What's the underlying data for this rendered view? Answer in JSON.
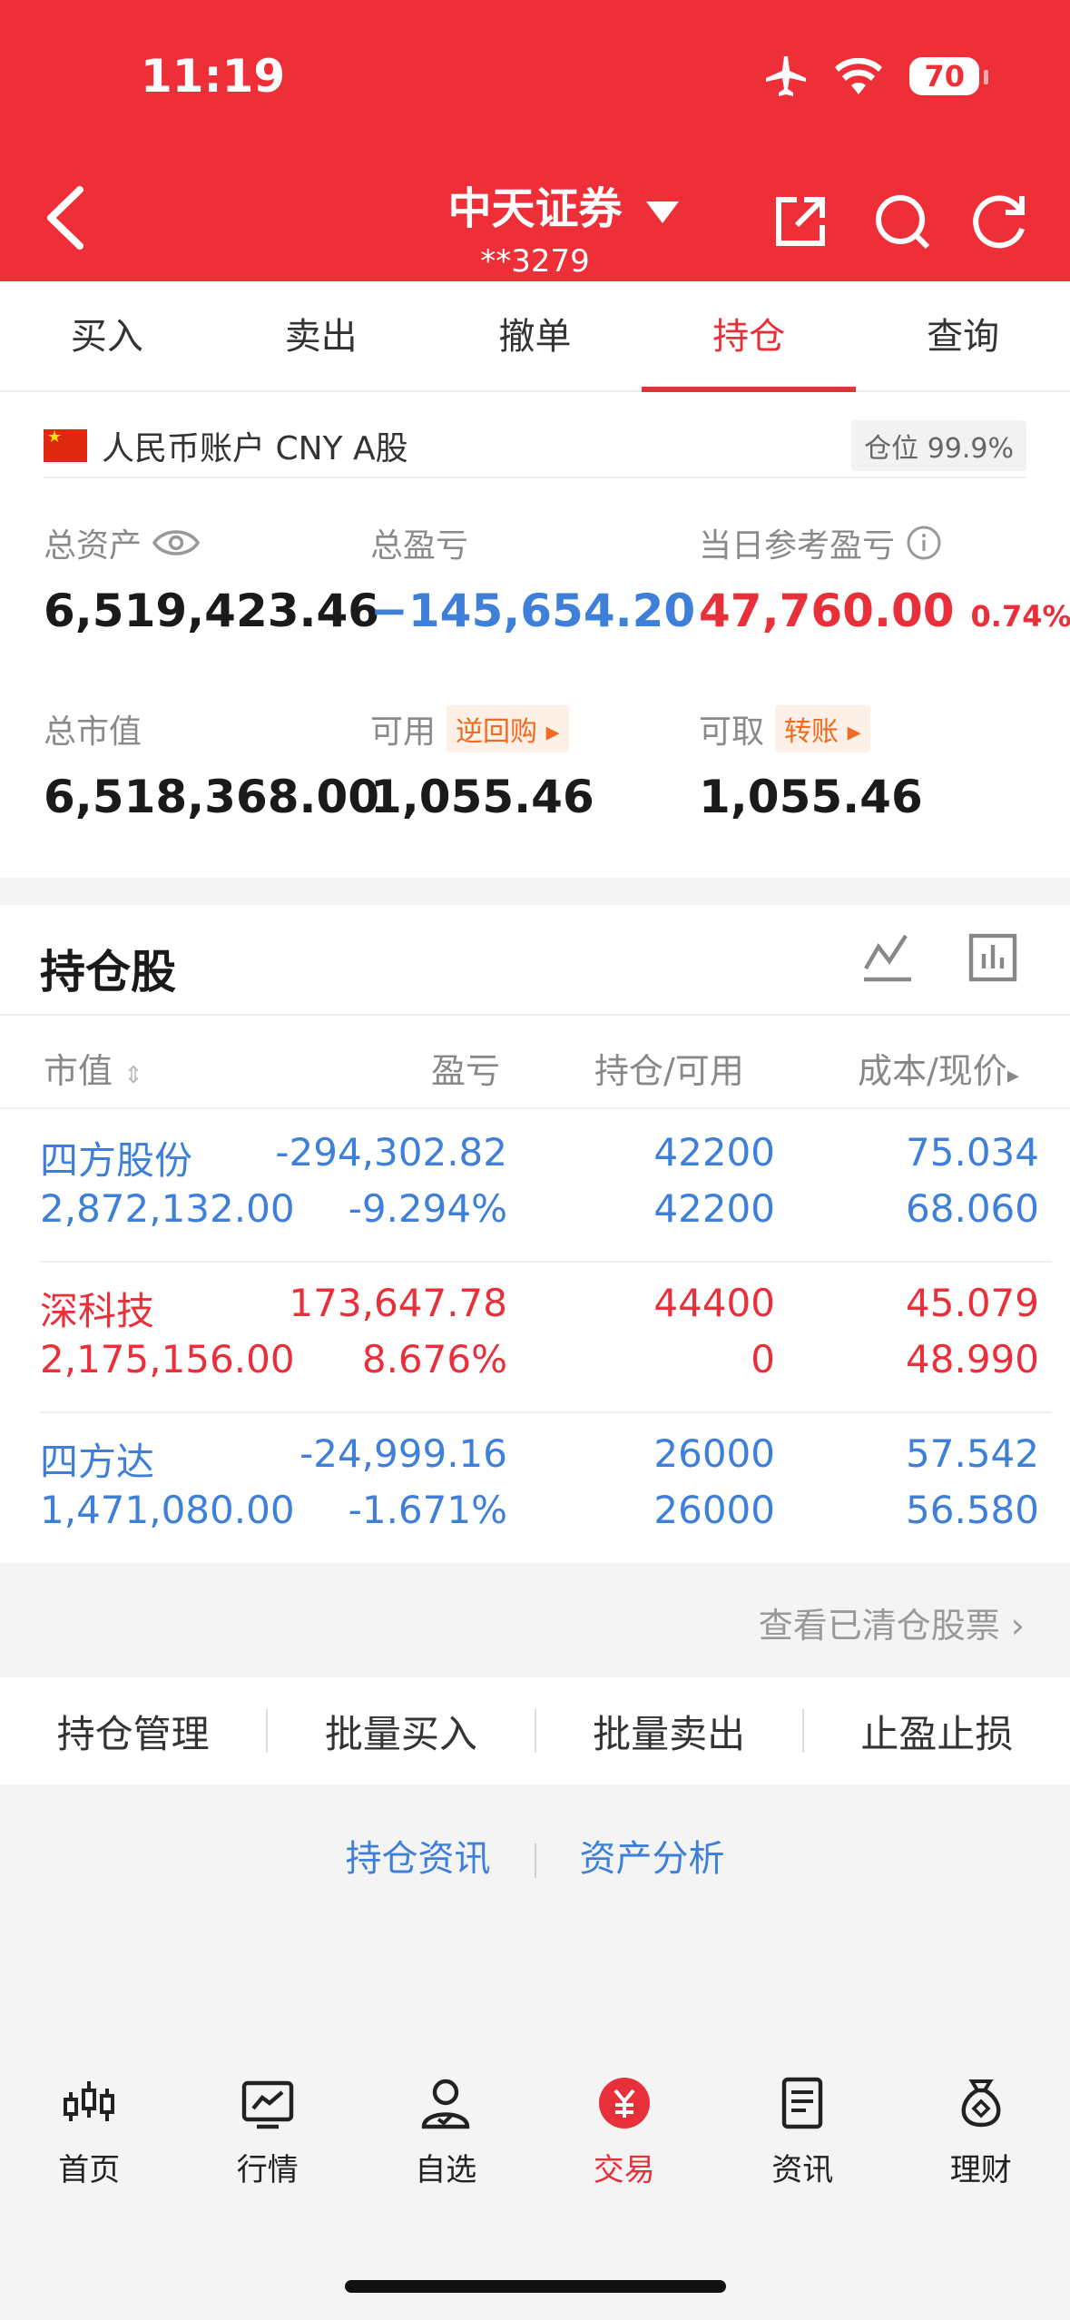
{
  "status_bar": {
    "time": "11:19",
    "battery": "70"
  },
  "header": {
    "title": "中天证券",
    "account": "**3279"
  },
  "tabs": [
    {
      "label": "买入",
      "active": false
    },
    {
      "label": "卖出",
      "active": false
    },
    {
      "label": "撤单",
      "active": false
    },
    {
      "label": "持仓",
      "active": true
    },
    {
      "label": "查询",
      "active": false
    }
  ],
  "account": {
    "label": "人民币账户 CNY A股",
    "position_badge": "仓位 99.9%",
    "total_assets_label": "总资产",
    "total_assets": "6,519,423.46",
    "total_pnl_label": "总盈亏",
    "total_pnl": "−145,654.20",
    "today_pnl_label": "当日参考盈亏",
    "today_pnl": "47,760.00",
    "today_pnl_pct": "0.74%",
    "market_value_label": "总市值",
    "market_value": "6,518,368.00",
    "available_label": "可用",
    "available_tag": "逆回购",
    "available": "1,055.46",
    "withdrawable_label": "可取",
    "withdrawable_tag": "转账",
    "withdrawable": "1,055.46"
  },
  "holdings": {
    "title": "持仓股",
    "columns": {
      "market_value": "市值",
      "pnl": "盈亏",
      "position": "持仓/可用",
      "cost": "成本/现价"
    },
    "rows": [
      {
        "name": "四方股份",
        "value": "2,872,132.00",
        "pnl": "-294,302.82",
        "pnl_pct": "-9.294%",
        "position": "42200",
        "available": "42200",
        "cost": "75.034",
        "price": "68.060",
        "trend": "down"
      },
      {
        "name": "深科技",
        "value": "2,175,156.00",
        "pnl": "173,647.78",
        "pnl_pct": "8.676%",
        "position": "44400",
        "available": "0",
        "cost": "45.079",
        "price": "48.990",
        "trend": "up"
      },
      {
        "name": "四方达",
        "value": "1,471,080.00",
        "pnl": "-24,999.16",
        "pnl_pct": "-1.671%",
        "position": "26000",
        "available": "26000",
        "cost": "57.542",
        "price": "56.580",
        "trend": "down"
      }
    ]
  },
  "cleared_link": "查看已清仓股票",
  "actions": [
    "持仓管理",
    "批量买入",
    "批量卖出",
    "止盈止损"
  ],
  "links": [
    "持仓资讯",
    "资产分析"
  ],
  "bottom_nav": [
    {
      "label": "首页",
      "icon": "candlestick-icon",
      "active": false
    },
    {
      "label": "行情",
      "icon": "chart-icon",
      "active": false
    },
    {
      "label": "自选",
      "icon": "user-check-icon",
      "active": false
    },
    {
      "label": "交易",
      "icon": "yuan-icon",
      "active": true
    },
    {
      "label": "资讯",
      "icon": "document-icon",
      "active": false
    },
    {
      "label": "理财",
      "icon": "money-bag-icon",
      "active": false
    }
  ],
  "colors": {
    "brand": "#ee2f37",
    "up": "#e8303a",
    "down": "#3d7fd9"
  }
}
